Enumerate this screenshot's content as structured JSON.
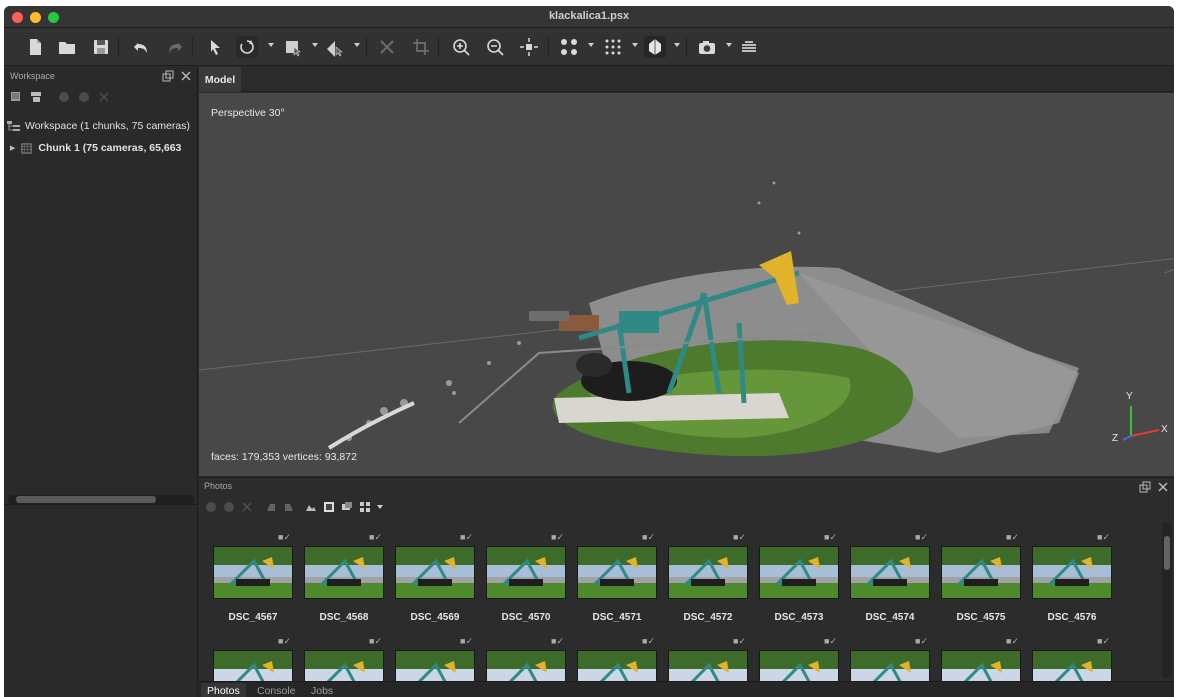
{
  "window": {
    "title": "klackalica1.psx"
  },
  "workspace": {
    "panel_title": "Workspace",
    "tree": [
      {
        "label": "Workspace (1 chunks, 75 cameras)"
      },
      {
        "label": "Chunk 1 (75 cameras, 65,663"
      }
    ]
  },
  "model": {
    "tab_label": "Model",
    "projection": "Perspective 30°",
    "stats": "faces: 179,353 vertices: 93,872",
    "axes": {
      "y": "Y",
      "x": "X",
      "z": "Z"
    }
  },
  "photos": {
    "panel_title": "Photos",
    "row1": [
      {
        "name": "DSC_4567"
      },
      {
        "name": "DSC_4568"
      },
      {
        "name": "DSC_4569"
      },
      {
        "name": "DSC_4570"
      },
      {
        "name": "DSC_4571"
      },
      {
        "name": "DSC_4572"
      },
      {
        "name": "DSC_4573"
      },
      {
        "name": "DSC_4574"
      },
      {
        "name": "DSC_4575"
      },
      {
        "name": "DSC_4576"
      }
    ]
  },
  "bottom_tabs": [
    {
      "label": "Photos"
    },
    {
      "label": "Console"
    },
    {
      "label": "Jobs"
    }
  ],
  "colors": {
    "accent_machine": "#2f8a86",
    "accent_head": "#e2b22a",
    "background": "#484848"
  }
}
